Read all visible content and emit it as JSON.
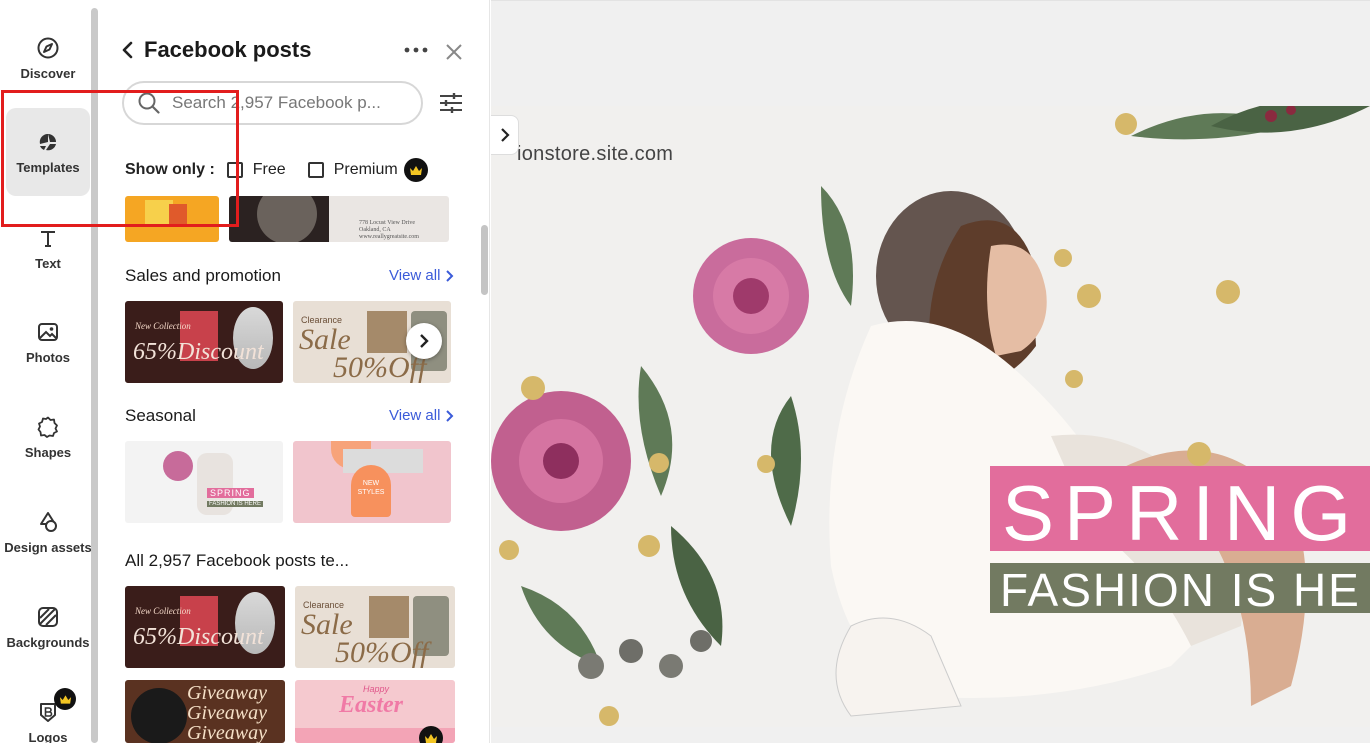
{
  "sidebar": {
    "items": [
      {
        "label": "Discover",
        "icon": "compass-icon"
      },
      {
        "label": "Templates",
        "icon": "templates-icon"
      },
      {
        "label": "Text",
        "icon": "text-icon"
      },
      {
        "label": "Photos",
        "icon": "photo-icon"
      },
      {
        "label": "Shapes",
        "icon": "shapes-icon"
      },
      {
        "label": "Design assets",
        "icon": "design-assets-icon"
      },
      {
        "label": "Backgrounds",
        "icon": "backgrounds-icon"
      },
      {
        "label": "Logos",
        "icon": "logo-icon"
      }
    ],
    "active": "Templates"
  },
  "panel": {
    "title": "Facebook posts",
    "search_placeholder": "Search 2,957 Facebook p...",
    "show_only_label": "Show only :",
    "filter_free": "Free",
    "filter_premium": "Premium",
    "sections": [
      {
        "title": "Sales and promotion",
        "view_all": "View all"
      },
      {
        "title": "Seasonal",
        "view_all": "View all"
      },
      {
        "title": "All 2,957 Facebook posts te..."
      }
    ],
    "thumbs": {
      "partial_address": "778 Locust View Drive\nOakland, CA\nwww.reallygreatsite.com",
      "sale1_sub": "New Collection",
      "sale1_title": "65%Discount",
      "sale2_small": "Clearance",
      "sale2_title": "Sale",
      "sale2_pct": "50%Off",
      "spring_small": "SPRING",
      "spring_sub": "FASHION IS HERE",
      "newstyles": "NEW STYLES",
      "giveaway": "Giveaway",
      "easter_top": "Happy",
      "easter_title": "Easter"
    }
  },
  "canvas": {
    "site_url": "ionstore.site.com",
    "headline": "SPRING",
    "subheadline": "FASHION IS HE",
    "colors": {
      "headline_bg": "#e26d9c",
      "subheadline_bg": "#727a61"
    }
  },
  "accent_color": "#3b5bd9",
  "annotation_color": "#e21d1d"
}
